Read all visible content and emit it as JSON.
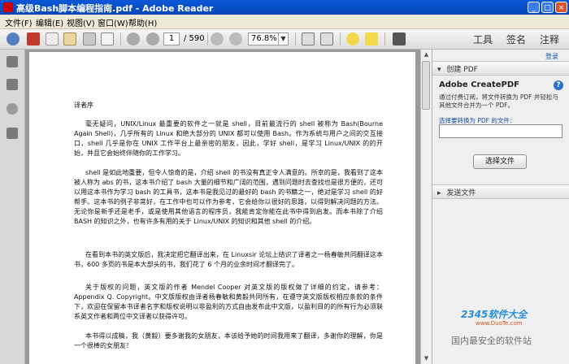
{
  "window": {
    "title": "高级Bash脚本编程指南.pdf - Adobe Reader",
    "min_label": "_",
    "max_label": "□",
    "close_label": "×"
  },
  "menu": [
    "文件(F)",
    "编辑(E)",
    "视图(V)",
    "窗口(W)",
    "帮助(H)"
  ],
  "toolbar": {
    "current_page": "1",
    "page_count": "/ 590",
    "zoom": "76.8%",
    "zoom_arrow": "▼",
    "tools_label": "工具",
    "sign_label": "签名",
    "comment_label": "注释"
  },
  "document": {
    "paragraphs": [
      "译者序",
      "毫无疑问，UNIX/Linux 最重要的软件之一就是 shell，目前最流行的 shell 被称为 Bash(Bourne Again Shell)，几乎所有的 Linux 和绝大部分的 UNIX 都可以使用 Bash。作为系统与用户之间的交互接口，shell 几乎是你在 UNIX 工作平台上最亲密的朋友，因此，学好 shell，是学习 Linux/UNIX 的的开始，并且它会始终伴随你的工作学习。",
      "shell 是如此地重要，但令人惊奇的是，介绍 shell 的书没有真正令人满意的。所幸的是，我看到了这本被人称为 abs 的书，这本书介绍了 bash 大量的细节和广阔的范围，遇到问题时去查找也是很方便的，还可以用这本书作为学习 bash 的工具书，这本书是我见过的最好的 bash 的书籍之一，绝对是学习 shell 的好帮手。这本书的例子非常好，在工作中也可以作为参考，它会给你以很好的思路，以得到解决问题的方法。无论你是新手还是老手，或是使用其他语言的程序员，我能肯定你能在此书中得到启发。而本书除了介绍 BASH 的知识之外，也有许多有用的关于 Linux/UNIX 的知识和其他 shell 的介绍。",
      "在看到本书的英文版后，我决定把它翻译出来，在 Linuxsir 论坛上结识了译者之一杨春敏共同翻译这本书，600 多页的书是本大部头的书，我们花了 6 个月的业余时间才翻译完了。",
      "关于版权的问题，英文版的作者 Mendel Cooper 对英文版的版权做了详细的约定，请参考：Appendix Q. Copyright。中文版版权由译者杨春敏和黄毅共同所有，在遵守英文版版权相应条款的条件下，欢迎在保留本书译者名字和版权说明以非盈利的方式自由发布此中文版，以盈利目的的所有行为必须联系英文作者和两位中文译者以获得许可。",
      "本书得以成稿，我（黄毅）要多谢我的女朋友，本该给予她的时间我用来了翻译，多谢你的理解，你是一个很棒的女朋友！"
    ]
  },
  "right_panel": {
    "top_link": "登录",
    "section_create": "创建 PDF",
    "section_create_arrow": "▾",
    "product_title": "Adobe CreatePDF",
    "help_icon_label": "?",
    "description": "通过付费订阅，将文件转换为 PDF 并轻松与其他文件合并为一个 PDF。",
    "select_link": "选择要转换为 PDF 的文件：",
    "file_value": "",
    "select_button": "选择文件",
    "section_send": "发送文件",
    "section_send_arrow": "▸"
  },
  "watermark": {
    "brand": "2345软件大全",
    "url": "www.DuoTe.com",
    "slogan": "国内最安全的软件站"
  },
  "colors": {
    "titlebar": "#0a58d6",
    "accent": "#2c6ed3"
  }
}
